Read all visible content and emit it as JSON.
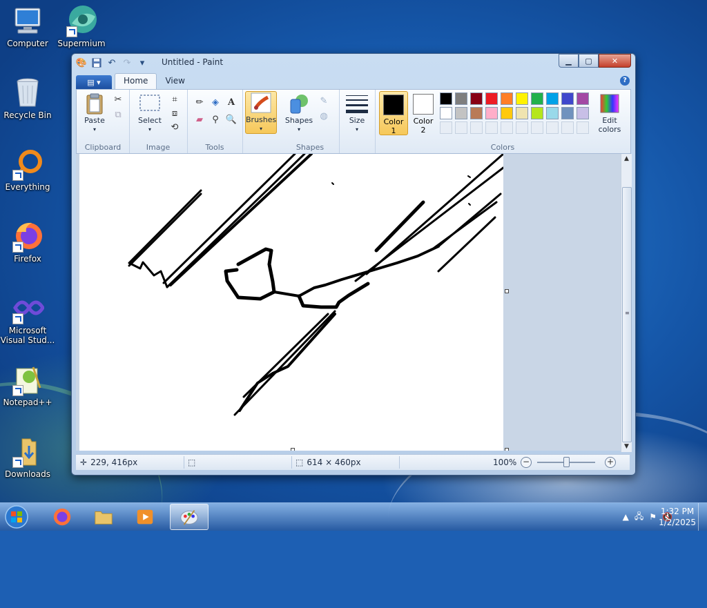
{
  "desktop": {
    "icons": [
      {
        "label": "Computer"
      },
      {
        "label": "Supermium"
      },
      {
        "label": "Recycle Bin"
      },
      {
        "label": "Everything"
      },
      {
        "label": "Firefox"
      },
      {
        "label": "Microsoft Visual Stud..."
      },
      {
        "label": "Notepad++"
      },
      {
        "label": "Downloads"
      }
    ]
  },
  "window": {
    "title": "Untitled - Paint",
    "menu_button": "▤ ▾",
    "tabs": [
      {
        "label": "Home"
      },
      {
        "label": "View"
      }
    ],
    "help": "?",
    "ribbon": {
      "clipboard": {
        "group_label": "Clipboard",
        "paste": "Paste"
      },
      "image": {
        "group_label": "Image",
        "select": "Select"
      },
      "tools": {
        "group_label": "Tools"
      },
      "brushes": {
        "label": "Brushes"
      },
      "shapes": {
        "group_label": "Shapes",
        "shapes": "Shapes"
      },
      "size": {
        "label": "Size"
      },
      "colors": {
        "group_label": "Colors",
        "color1": {
          "label": "Color",
          "num": "1",
          "value": "#000000"
        },
        "color2": {
          "label": "Color",
          "num": "2",
          "value": "#ffffff"
        },
        "edit_colors": {
          "line1": "Edit",
          "line2": "colors"
        },
        "palette_row1": [
          "#000000",
          "#7f7f7f",
          "#880015",
          "#ed1c24",
          "#ff7f27",
          "#fff200",
          "#22b14c",
          "#00a2e8",
          "#3f48cc",
          "#a349a4"
        ],
        "palette_row2": [
          "#ffffff",
          "#c3c3c3",
          "#b97a57",
          "#ffaec9",
          "#ffc90e",
          "#efe4b0",
          "#b5e61d",
          "#99d9ea",
          "#7092be",
          "#c8bfe7"
        ]
      }
    },
    "status": {
      "cursor_pos": "229, 416px",
      "canvas_size": "614 × 460px",
      "zoom": "100%"
    }
  },
  "taskbar": {
    "clock_time": "1:32 PM",
    "clock_date": "1/2/2025"
  }
}
